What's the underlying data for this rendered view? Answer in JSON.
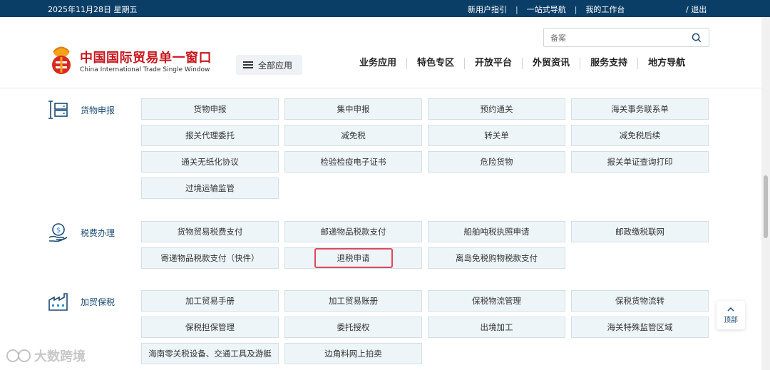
{
  "topbar": {
    "date": "2025年11月28日  星期五",
    "links": [
      "新用户指引",
      "一站式导航",
      "我的工作台"
    ],
    "logout": "/  退出"
  },
  "header": {
    "logo_cn": "中国国际贸易单一窗口",
    "logo_en": "China International Trade Single Window",
    "all_apps": "全部应用",
    "search_placeholder": "备案",
    "nav": [
      "业务应用",
      "特色专区",
      "开放平台",
      "外贸资讯",
      "服务支持",
      "地方导航"
    ]
  },
  "sections": [
    {
      "title": "货物申报",
      "icon": "cargo-declaration-icon",
      "items": [
        "货物申报",
        "集中申报",
        "预约通关",
        "海关事务联系单",
        "报关代理委托",
        "减免税",
        "转关单",
        "减免税后续",
        "通关无纸化协议",
        "检验检疫电子证书",
        "危险货物",
        "报关单证查询打印",
        "过境运输监管"
      ]
    },
    {
      "title": "税费办理",
      "icon": "tax-payment-icon",
      "items": [
        "货物贸易税费支付",
        "邮递物品税款支付",
        "船舶吨税执照申请",
        "邮政缴税联网",
        "寄递物品税款支付（快件）",
        "退税申请",
        "离岛免税购物税款支付"
      ]
    },
    {
      "title": "加贸保税",
      "icon": "factory-icon",
      "items": [
        "加工贸易手册",
        "加工贸易账册",
        "保税物流管理",
        "保税货物流转",
        "保税担保管理",
        "委托授权",
        "出境加工",
        "海关特殊监管区域",
        "海南零关税设备、交通工具及游艇",
        "边角料网上拍卖"
      ]
    }
  ],
  "highlighted_item": "退税申请",
  "to_top": "顶部",
  "watermark": "大数跨境",
  "colors": {
    "topbar": "#0b3e66",
    "tile_bg": "#eef5f8",
    "highlight": "#e0475c",
    "logo_red": "#c8161d"
  }
}
